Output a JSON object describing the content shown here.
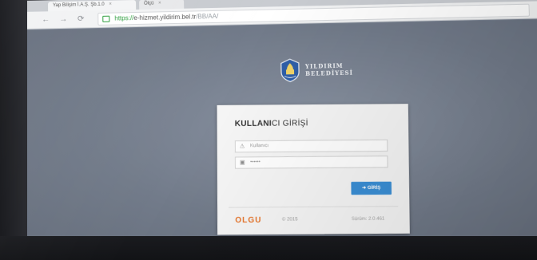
{
  "browser": {
    "tabs": [
      {
        "label": "Yap Bilişim İ.A.Ş. Şb.1.0"
      },
      {
        "label": "Ölçü"
      }
    ],
    "address": {
      "scheme": "https://",
      "host": "e-hizmet.yildirim.bel.tr",
      "path": "/BB/AA/"
    },
    "nav": {
      "back": "←",
      "forward": "→",
      "reload": "⟳"
    }
  },
  "logo": {
    "line1": "YILDIRIM",
    "line2": "BELEDİYESİ"
  },
  "login": {
    "title_bold": "KULLANI",
    "title_rest": "CI GİRİŞİ",
    "username_placeholder": "Kullanıcı",
    "password_placeholder": "••••••",
    "submit_label": "➜ GİRİŞ",
    "brand": "OLGU",
    "brand_year": "© 2015",
    "version": "Sürüm: 2.0.461"
  },
  "colors": {
    "button": "#3b8fd6",
    "brand": "#e8762c",
    "secure": "#2a9d3a",
    "page_bg": "#77808f"
  }
}
